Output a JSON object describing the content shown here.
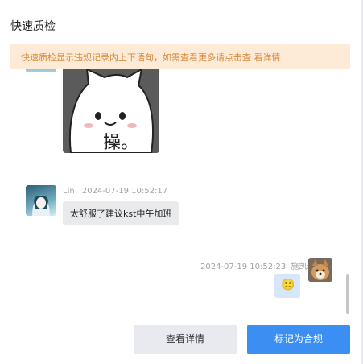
{
  "dialog": {
    "title": "快速质检",
    "notice": "快速质检显示违规记录内上下语句，如需查看更多请点击查 看详情"
  },
  "messages": [
    {
      "type": "sticker",
      "sticker_text": "操。"
    },
    {
      "type": "text",
      "sender": "Lin",
      "time": "2024-07-19 10:52:17",
      "text": "太舒服了建议kst中午加班"
    },
    {
      "type": "emoji",
      "sender": "施凯玲",
      "time": "2024-07-19 10:52:23",
      "emoji": "🙂"
    }
  ],
  "actions": {
    "view_details": "查看详情",
    "mark_compliant": "标记为合规"
  },
  "colors": {
    "primary": "#3b8ef2",
    "notice_bg": "#fdebd8",
    "notice_text": "#d98a3a"
  }
}
